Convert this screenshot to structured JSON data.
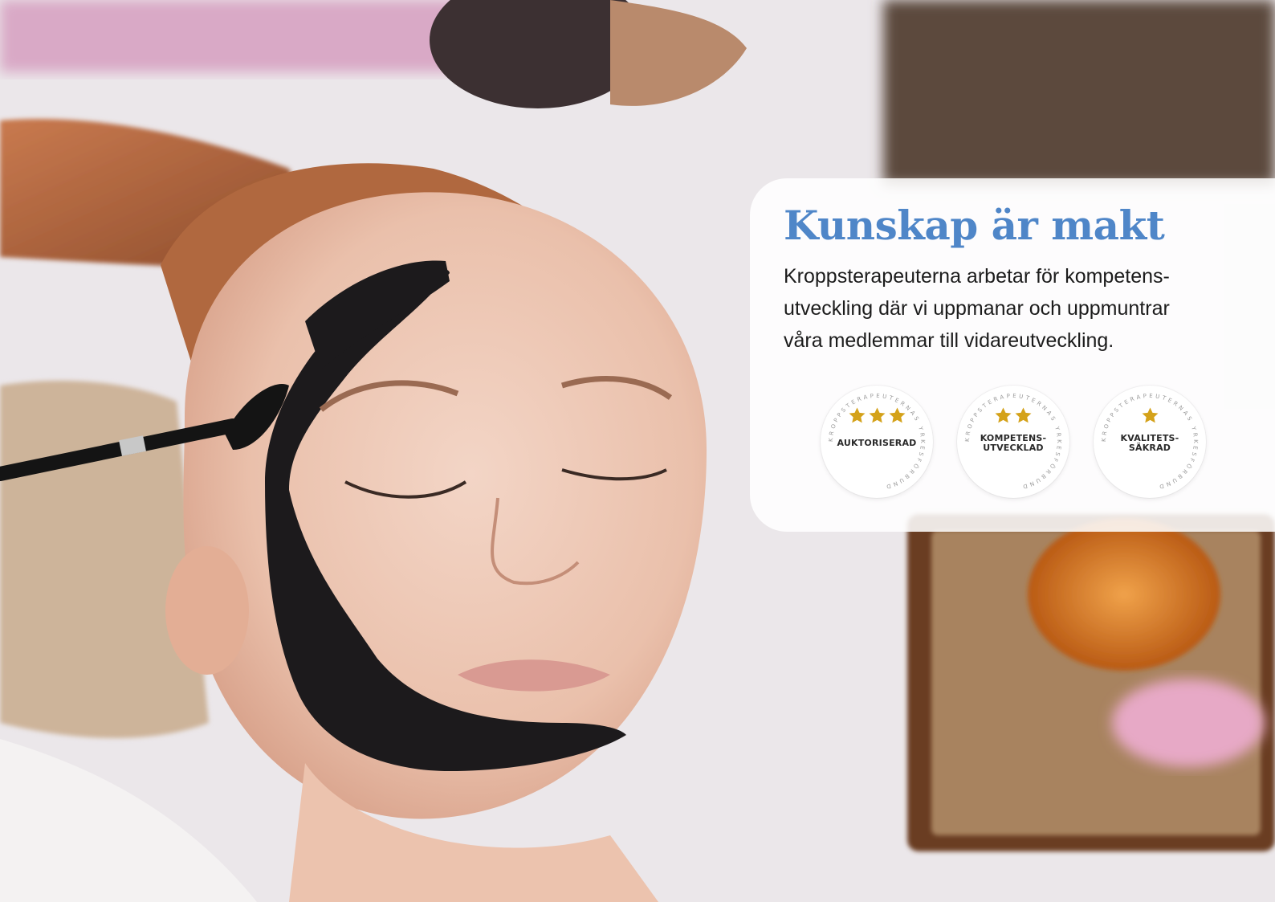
{
  "headline": "Kunskap är makt",
  "body_lines": [
    "Kroppsterapeuterna arbetar för kompetens-",
    "utveckling där vi uppmanar och uppmuntrar",
    "våra medlemmar till vidareutveckling."
  ],
  "badges": [
    {
      "stars": 3,
      "label_lines": [
        "AUKTORISERAD"
      ],
      "ring_text": "KROPPSTERAPEUTERNAS YRKESFÖRBUND"
    },
    {
      "stars": 2,
      "label_lines": [
        "KOMPETENS-",
        "UTVECKLAD"
      ],
      "ring_text": "KROPPSTERAPEUTERNAS YRKESFÖRBUND"
    },
    {
      "stars": 1,
      "label_lines": [
        "KVALITETS-",
        "SÄKRAD"
      ],
      "ring_text": "KROPPSTERAPEUTERNAS YRKESFÖRBUND"
    }
  ],
  "colors": {
    "headline": "#4f86c8",
    "star": "#d4a21a",
    "text": "#1c1c1c"
  },
  "image": {
    "subject": "spa-facial-mask-photo"
  }
}
